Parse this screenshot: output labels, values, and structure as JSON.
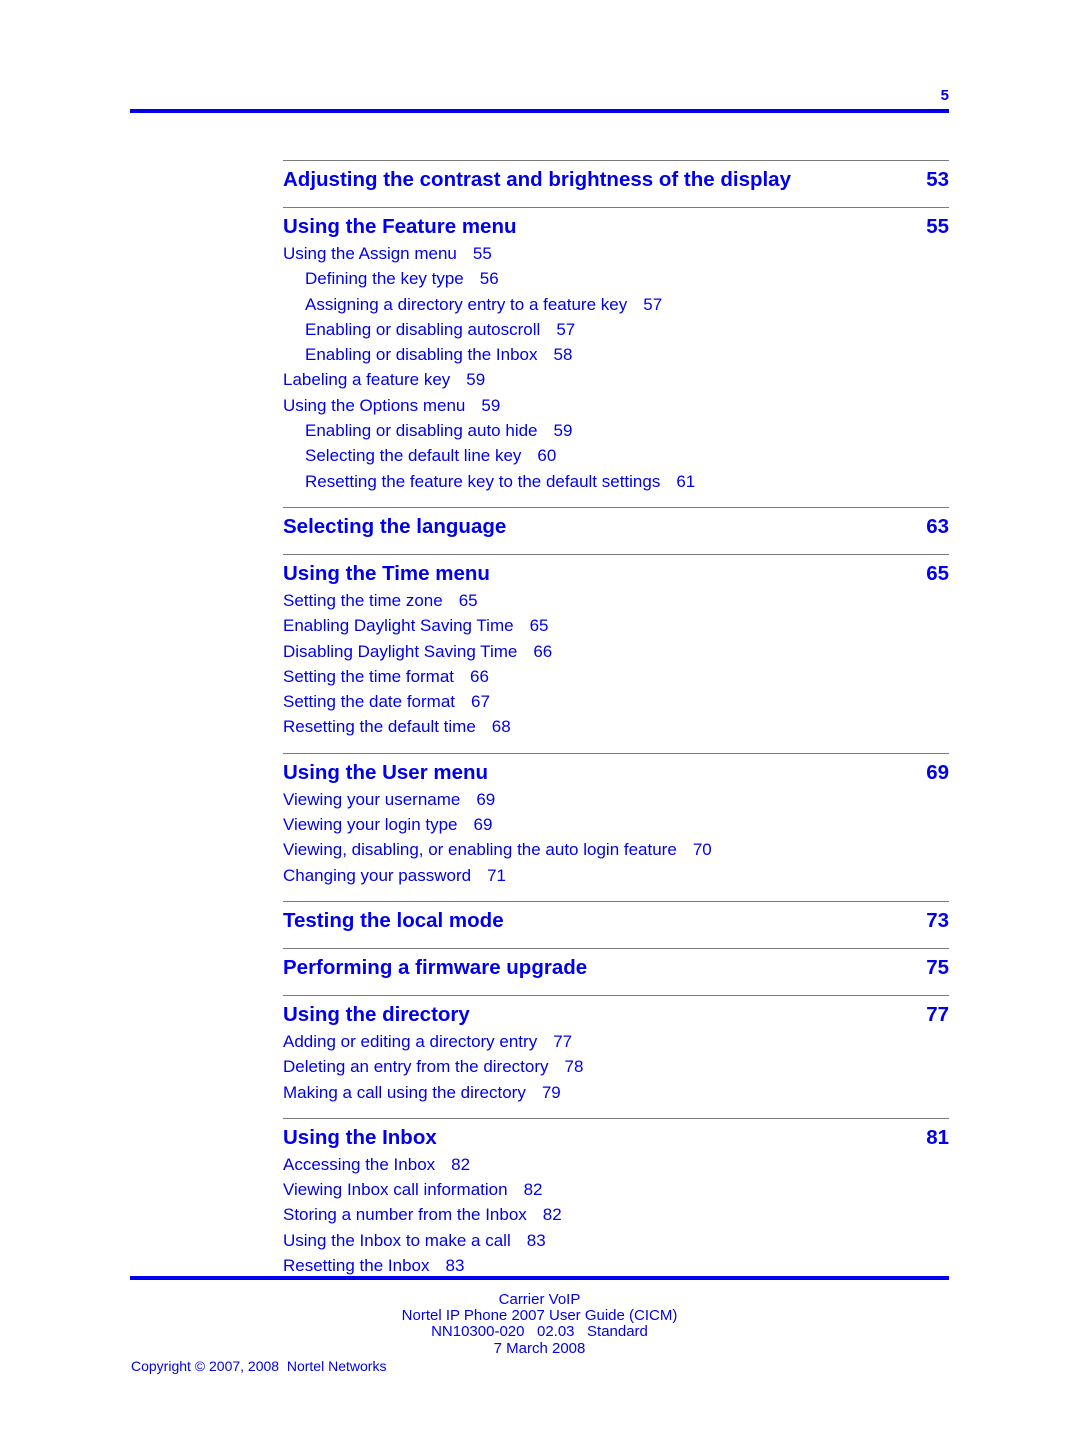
{
  "header": {
    "page_number": "5"
  },
  "sections": [
    {
      "title": "Adjusting the contrast and brightness of the display",
      "page": "53",
      "entries": []
    },
    {
      "title": "Using the Feature menu",
      "page": "55",
      "entries": [
        {
          "label": "Using the Assign menu",
          "page": "55",
          "level": 1
        },
        {
          "label": "Defining the key type",
          "page": "56",
          "level": 2
        },
        {
          "label": "Assigning a directory entry to a feature key",
          "page": "57",
          "level": 2
        },
        {
          "label": "Enabling or disabling autoscroll",
          "page": "57",
          "level": 2
        },
        {
          "label": "Enabling or disabling the Inbox",
          "page": "58",
          "level": 2
        },
        {
          "label": "Labeling a feature key",
          "page": "59",
          "level": 1
        },
        {
          "label": "Using the Options menu",
          "page": "59",
          "level": 1
        },
        {
          "label": "Enabling or disabling auto hide",
          "page": "59",
          "level": 2
        },
        {
          "label": "Selecting the default line key",
          "page": "60",
          "level": 2
        },
        {
          "label": "Resetting the feature key to the default settings",
          "page": "61",
          "level": 2
        }
      ]
    },
    {
      "title": "Selecting the language",
      "page": "63",
      "entries": []
    },
    {
      "title": "Using the Time menu",
      "page": "65",
      "entries": [
        {
          "label": "Setting the time zone",
          "page": "65",
          "level": 1
        },
        {
          "label": "Enabling Daylight Saving Time",
          "page": "65",
          "level": 1
        },
        {
          "label": "Disabling Daylight Saving Time",
          "page": "66",
          "level": 1
        },
        {
          "label": "Setting the time format",
          "page": "66",
          "level": 1
        },
        {
          "label": "Setting the date format",
          "page": "67",
          "level": 1
        },
        {
          "label": "Resetting the default time",
          "page": "68",
          "level": 1
        }
      ]
    },
    {
      "title": "Using the User menu",
      "page": "69",
      "entries": [
        {
          "label": "Viewing your username",
          "page": "69",
          "level": 1
        },
        {
          "label": "Viewing your login type",
          "page": "69",
          "level": 1
        },
        {
          "label": "Viewing, disabling, or enabling the auto login feature",
          "page": "70",
          "level": 1
        },
        {
          "label": "Changing your password",
          "page": "71",
          "level": 1
        }
      ]
    },
    {
      "title": "Testing the local mode",
      "page": "73",
      "entries": []
    },
    {
      "title": "Performing a firmware upgrade",
      "page": "75",
      "entries": []
    },
    {
      "title": "Using the directory",
      "page": "77",
      "entries": [
        {
          "label": "Adding or editing a directory entry",
          "page": "77",
          "level": 1
        },
        {
          "label": "Deleting an entry from the directory",
          "page": "78",
          "level": 1
        },
        {
          "label": "Making a call using the directory",
          "page": "79",
          "level": 1
        }
      ]
    },
    {
      "title": "Using the Inbox",
      "page": "81",
      "entries": [
        {
          "label": "Accessing the Inbox",
          "page": "82",
          "level": 1
        },
        {
          "label": "Viewing Inbox call information",
          "page": "82",
          "level": 1
        },
        {
          "label": "Storing a number from the Inbox",
          "page": "82",
          "level": 1
        },
        {
          "label": "Using the Inbox to make a call",
          "page": "83",
          "level": 1
        },
        {
          "label": "Resetting the Inbox",
          "page": "83",
          "level": 1
        }
      ]
    }
  ],
  "footer": {
    "line1": "Carrier VoIP",
    "line2": "Nortel IP Phone 2007 User Guide (CICM)",
    "line3": "NN10300-020   02.03   Standard",
    "line4": "7 March 2008",
    "copyright": "Copyright © 2007, 2008  Nortel Networks"
  }
}
